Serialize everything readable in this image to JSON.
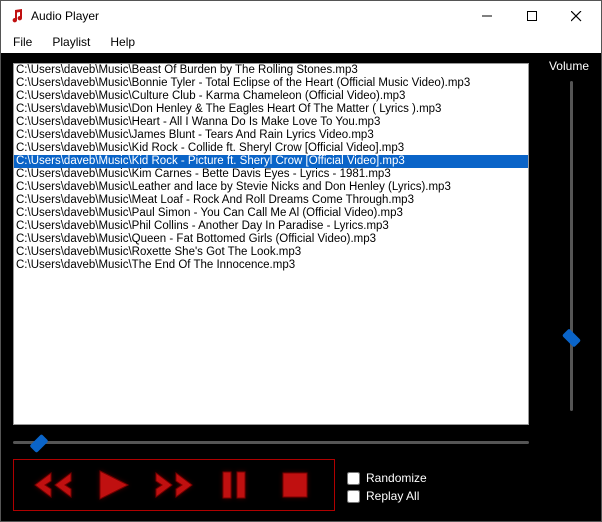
{
  "window": {
    "title": "Audio Player"
  },
  "menu": {
    "file": "File",
    "playlist": "Playlist",
    "help": "Help"
  },
  "volume": {
    "label": "Volume",
    "value": 22
  },
  "seek": {
    "value": 5
  },
  "playlist_items": [
    "C:\\Users\\daveb\\Music\\Beast Of Burden by The Rolling Stones.mp3",
    "C:\\Users\\daveb\\Music\\Bonnie Tyler - Total Eclipse of the Heart (Official Music Video).mp3",
    "C:\\Users\\daveb\\Music\\Culture Club - Karma Chameleon (Official Video).mp3",
    "C:\\Users\\daveb\\Music\\Don Henley & The Eagles Heart Of The Matter ( Lyrics ).mp3",
    "C:\\Users\\daveb\\Music\\Heart - All I Wanna Do Is Make Love To You.mp3",
    "C:\\Users\\daveb\\Music\\James Blunt - Tears And Rain Lyrics Video.mp3",
    "C:\\Users\\daveb\\Music\\Kid Rock - Collide ft. Sheryl Crow [Official Video].mp3",
    "C:\\Users\\daveb\\Music\\Kid Rock - Picture ft. Sheryl Crow [Official Video].mp3",
    "C:\\Users\\daveb\\Music\\Kim Carnes - Bette Davis Eyes - Lyrics - 1981.mp3",
    "C:\\Users\\daveb\\Music\\Leather and lace by Stevie Nicks and Don Henley (Lyrics).mp3",
    "C:\\Users\\daveb\\Music\\Meat Loaf - Rock And Roll Dreams Come Through.mp3",
    "C:\\Users\\daveb\\Music\\Paul Simon - You Can Call Me Al (Official Video).mp3",
    "C:\\Users\\daveb\\Music\\Phil Collins - Another Day In Paradise - Lyrics.mp3",
    "C:\\Users\\daveb\\Music\\Queen - Fat Bottomed Girls (Official Video).mp3",
    "C:\\Users\\daveb\\Music\\Roxette She's Got The Look.mp3",
    "C:\\Users\\daveb\\Music\\The End Of The Innocence.mp3"
  ],
  "selected_index": 7,
  "options": {
    "randomize": "Randomize",
    "replay_all": "Replay All"
  },
  "colors": {
    "selection": "#0a64c8",
    "control_red": "#c01010"
  }
}
